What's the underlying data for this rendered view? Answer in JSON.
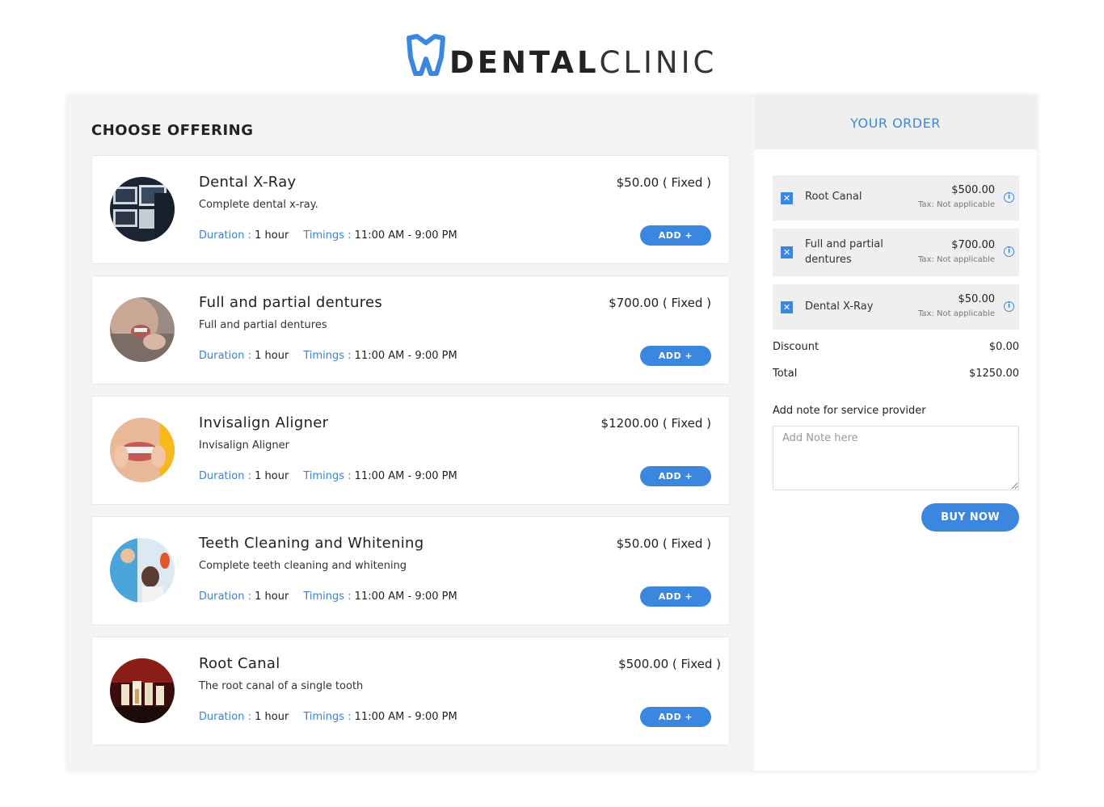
{
  "brand": {
    "logo_bold": "DENTAL",
    "logo_light": "CLINIC",
    "accent": "#3b87e0"
  },
  "offerings": {
    "title": "CHOOSE OFFERING",
    "duration_label": "Duration :",
    "timings_label": "Timings :",
    "add_label": "ADD +",
    "items": [
      {
        "name": "Dental X-Ray",
        "desc": "Complete dental x-ray.",
        "price": "$50.00 ( Fixed )",
        "duration": "1 hour",
        "timings": "11:00 AM - 9:00 PM"
      },
      {
        "name": "Full and partial dentures",
        "desc": "Full and partial dentures",
        "price": "$700.00 ( Fixed )",
        "duration": "1 hour",
        "timings": "11:00 AM - 9:00 PM"
      },
      {
        "name": "Invisalign Aligner",
        "desc": "Invisalign Aligner",
        "price": "$1200.00 ( Fixed )",
        "duration": "1 hour",
        "timings": "11:00 AM - 9:00 PM"
      },
      {
        "name": "Teeth Cleaning and Whitening",
        "desc": "Complete teeth cleaning and whitening",
        "price": "$50.00 ( Fixed )",
        "duration": "1 hour",
        "timings": "11:00 AM - 9:00 PM"
      },
      {
        "name": "Root Canal",
        "desc": "The root canal of a single tooth",
        "price": "$500.00 ( Fixed )",
        "duration": "1 hour",
        "timings": "11:00 AM - 9:00 PM"
      }
    ]
  },
  "order": {
    "title": "YOUR ORDER",
    "items": [
      {
        "name": "Root Canal",
        "price": "$500.00",
        "tax": "Tax: Not applicable"
      },
      {
        "name": "Full and partial dentures",
        "price": "$700.00",
        "tax": "Tax: Not applicable"
      },
      {
        "name": "Dental X-Ray",
        "price": "$50.00",
        "tax": "Tax: Not applicable"
      }
    ],
    "discount_label": "Discount",
    "discount_value": "$0.00",
    "total_label": "Total",
    "total_value": "$1250.00",
    "note_label": "Add note for service provider",
    "note_placeholder": "Add Note here",
    "buy_label": "BUY NOW"
  }
}
